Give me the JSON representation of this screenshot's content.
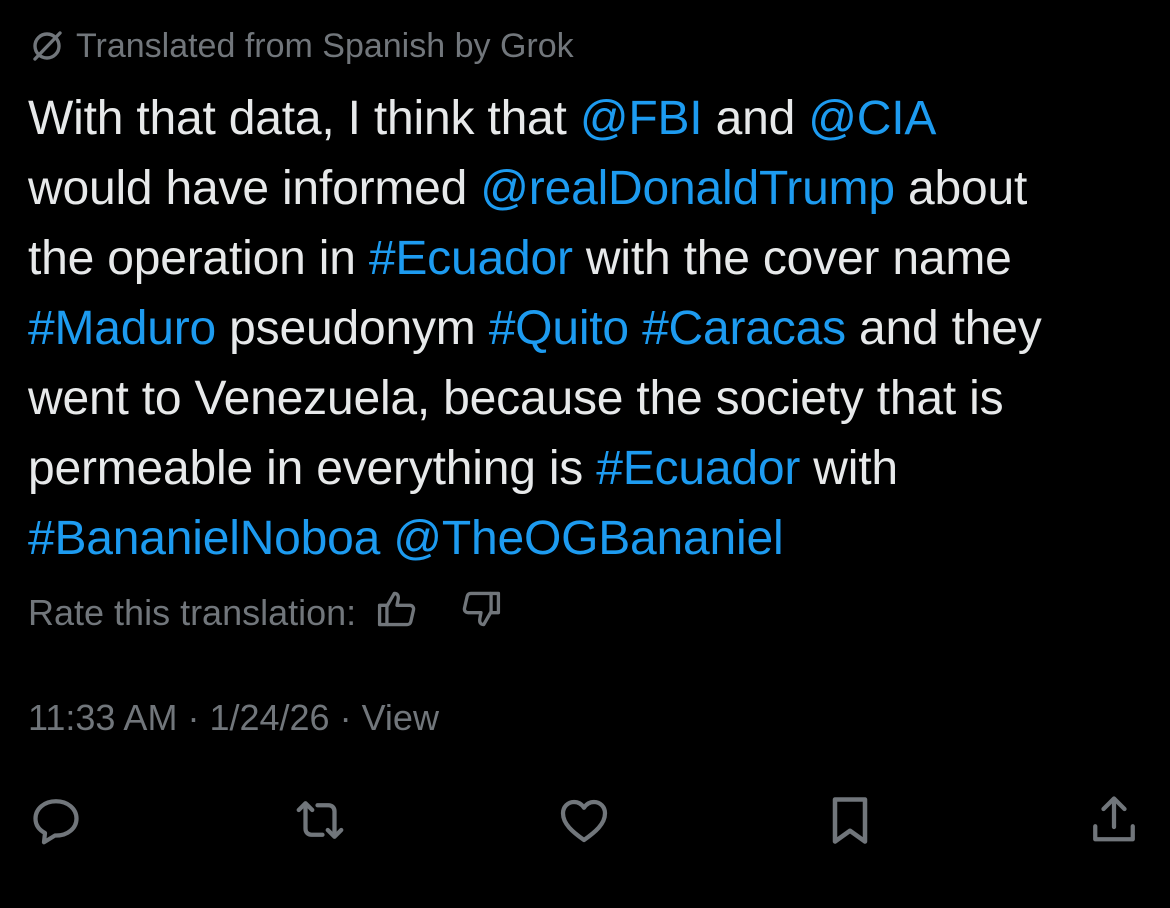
{
  "translation": {
    "notice": "Translated from Spanish by Grok"
  },
  "tweet": {
    "lines": [
      [
        {
          "text": "With that data, I think that "
        },
        {
          "text": "@FBI",
          "link": true
        },
        {
          "text": " and "
        },
        {
          "text": "@CIA",
          "link": true
        }
      ],
      [
        {
          "text": "would have informed "
        },
        {
          "text": "@realDonaldTrump",
          "link": true
        },
        {
          "text": " about"
        }
      ],
      [
        {
          "text": "the operation in "
        },
        {
          "text": "#Ecuador",
          "link": true
        },
        {
          "text": " with the cover name"
        }
      ],
      [
        {
          "text": "#Maduro",
          "link": true
        },
        {
          "text": " pseudonym "
        },
        {
          "text": "#Quito",
          "link": true
        },
        {
          "text": " "
        },
        {
          "text": "#Caracas",
          "link": true
        },
        {
          "text": " and they"
        }
      ],
      [
        {
          "text": "went to Venezuela, because the society that is"
        }
      ],
      [
        {
          "text": "permeable in everything is "
        },
        {
          "text": "#Ecuador",
          "link": true
        },
        {
          "text": " with"
        }
      ],
      [
        {
          "text": "#BananielNoboa",
          "link": true
        },
        {
          "text": " "
        },
        {
          "text": "@TheOGBananiel",
          "link": true
        }
      ]
    ]
  },
  "rate": {
    "label": "Rate this translation:",
    "thumbs_up_icon": "thumbs-up-icon",
    "thumbs_down_icon": "thumbs-down-icon"
  },
  "meta": {
    "time": "11:33 AM",
    "date": "1/24/26",
    "separator": "·",
    "view_label": "View"
  },
  "actions": [
    {
      "name": "reply-button",
      "icon": "reply-icon"
    },
    {
      "name": "repost-button",
      "icon": "repost-icon"
    },
    {
      "name": "like-button",
      "icon": "heart-icon"
    },
    {
      "name": "bookmark-button",
      "icon": "bookmark-icon"
    },
    {
      "name": "share-button",
      "icon": "share-icon"
    }
  ],
  "colors": {
    "background": "#000000",
    "text": "#e7e9ea",
    "muted": "#71767b",
    "link": "#1d9bf0"
  }
}
